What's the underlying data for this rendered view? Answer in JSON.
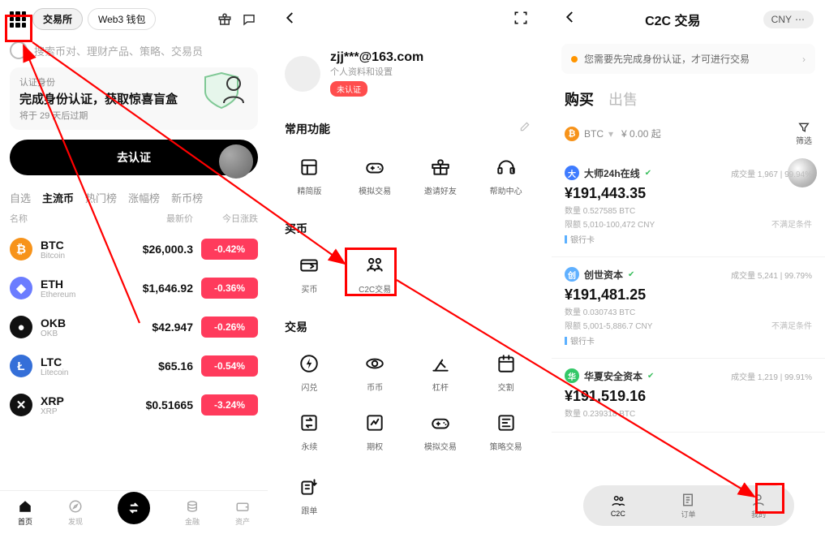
{
  "colors": {
    "accent_red": "#ff3b5c",
    "annotation_red": "#ff0000",
    "btc_orange": "#f7931a"
  },
  "phone1": {
    "header": {
      "pills": [
        {
          "label": "交易所",
          "active": true
        },
        {
          "label": "Web3 钱包",
          "active": false
        }
      ],
      "gift_icon": "gift",
      "chat_icon": "chat"
    },
    "search_placeholder": "搜索币对、理财产品、策略、交易员",
    "verify_card": {
      "small": "认证身份",
      "title": "完成身份认证，获取惊喜盲盒",
      "sub": "将于 29 天后过期",
      "button": "去认证"
    },
    "tabs": [
      "自选",
      "主流币",
      "热门榜",
      "涨幅榜",
      "新币榜"
    ],
    "tabs_active_index": 1,
    "cols": {
      "name": "名称",
      "price": "最新价",
      "chg": "今日涨跌"
    },
    "coins": [
      {
        "sym": "BTC",
        "full": "Bitcoin",
        "price": "$26,000.3",
        "chg": "-0.42%",
        "icon_bg": "#f7931a",
        "glyph": "₿"
      },
      {
        "sym": "ETH",
        "full": "Ethereum",
        "price": "$1,646.92",
        "chg": "-0.36%",
        "icon_bg": "#6b7cff",
        "glyph": "◆"
      },
      {
        "sym": "OKB",
        "full": "OKB",
        "price": "$42.947",
        "chg": "-0.26%",
        "icon_bg": "#111",
        "glyph": "●"
      },
      {
        "sym": "LTC",
        "full": "Litecoin",
        "price": "$65.16",
        "chg": "-0.54%",
        "icon_bg": "#356fd8",
        "glyph": "Ł"
      },
      {
        "sym": "XRP",
        "full": "XRP",
        "price": "$0.51665",
        "chg": "-3.24%",
        "icon_bg": "#111",
        "glyph": "✕"
      }
    ],
    "bottom_nav": [
      "首页",
      "发现",
      "",
      "金融",
      "资产"
    ]
  },
  "phone2": {
    "profile_name": "zjj***@163.com",
    "profile_sub": "个人资料和设置",
    "badge": "未认证",
    "section_common": "常用功能",
    "common_items": [
      {
        "label": "精简版",
        "icon": "layout-icon"
      },
      {
        "label": "模拟交易",
        "icon": "controller-icon"
      },
      {
        "label": "邀请好友",
        "icon": "gift-icon"
      },
      {
        "label": "帮助中心",
        "icon": "headset-icon"
      }
    ],
    "section_buy": "买币",
    "buy_items": [
      {
        "label": "买币",
        "icon": "card-arrow-icon"
      },
      {
        "label": "C2C交易",
        "icon": "people-swap-icon"
      }
    ],
    "section_trade": "交易",
    "trade_items": [
      {
        "label": "闪兑",
        "icon": "bolt-cycle-icon"
      },
      {
        "label": "币币",
        "icon": "orbit-icon"
      },
      {
        "label": "杠杆",
        "icon": "lever-icon"
      },
      {
        "label": "交割",
        "icon": "calendar-icon"
      },
      {
        "label": "永续",
        "icon": "repeat-box-icon"
      },
      {
        "label": "期权",
        "icon": "option-box-icon"
      },
      {
        "label": "模拟交易",
        "icon": "controller-icon"
      },
      {
        "label": "策略交易",
        "icon": "flow-box-icon"
      }
    ],
    "section_more_row": [
      {
        "label": "跟单",
        "icon": "follow-icon"
      }
    ]
  },
  "phone3": {
    "title": "C2C 交易",
    "currency_chip": "CNY",
    "notice": "您需要先完成身份认证，才可进行交易",
    "buy_label": "购买",
    "sell_label": "出售",
    "asset_chip": {
      "sym": "BTC",
      "text": "¥ 0.00 起"
    },
    "filter_label": "筛选",
    "merchants": [
      {
        "name": "大师24h在线",
        "avatar_bg": "#3e7bff",
        "avatar_txt": "大",
        "stats": "成交量 1,967 | 99.94%",
        "price": "¥191,443.35",
        "qty": "数量 0.527585 BTC",
        "range": "限额 5,010-100,472 CNY",
        "tag_right": "不满足条件",
        "pay": "银行卡"
      },
      {
        "name": "创世资本",
        "avatar_bg": "#5fb0ff",
        "avatar_txt": "创",
        "stats": "成交量 5,241 | 99.79%",
        "price": "¥191,481.25",
        "qty": "数量 0.030743 BTC",
        "range": "限额 5,001-5,886.7 CNY",
        "tag_right": "不满足条件",
        "pay": "银行卡"
      },
      {
        "name": "华夏安全资本",
        "avatar_bg": "#34c868",
        "avatar_txt": "华",
        "stats": "成交量 1,219 | 99.91%",
        "price": "¥191,519.16",
        "qty": "数量 0.239318 BTC",
        "range": "",
        "tag_right": "",
        "pay": ""
      }
    ],
    "bottom_nav": [
      {
        "label": "C2C",
        "icon": "people-icon"
      },
      {
        "label": "订单",
        "icon": "receipt-icon"
      },
      {
        "label": "我的",
        "icon": "user-icon"
      }
    ]
  }
}
